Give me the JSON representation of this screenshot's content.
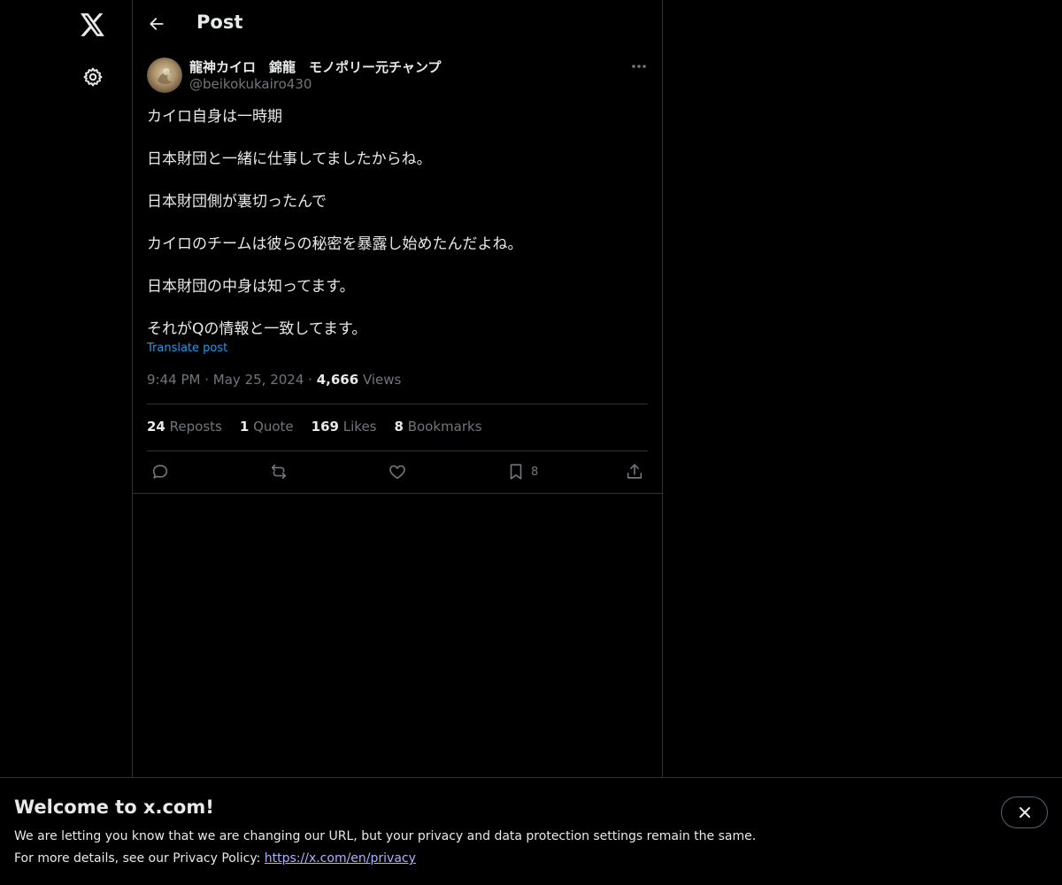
{
  "header": {
    "title": "Post"
  },
  "post": {
    "author": {
      "display_name": "龍神カイロ　錦龍　モノポリー元チャンプ",
      "handle": "@beikokukairo430"
    },
    "lines": [
      "カイロ自身は一時期",
      "",
      "日本財団と一緒に仕事してましたからね。",
      "",
      "日本財団側が裏切ったんで",
      "",
      "カイロのチームは彼らの秘密を暴露し始めたんだよね。",
      "",
      "日本財団の中身は知ってます。",
      "",
      "それがQの情報と一致してます。"
    ],
    "translate_label": "Translate post",
    "time": "9:44 PM",
    "separator": "·",
    "date": "May 25, 2024",
    "views_count": "4,666",
    "views_label": "Views"
  },
  "stats": {
    "reposts": {
      "count": "24",
      "label": "Reposts"
    },
    "quotes": {
      "count": "1",
      "label": "Quote"
    },
    "likes": {
      "count": "169",
      "label": "Likes"
    },
    "bookmarks": {
      "count": "8",
      "label": "Bookmarks"
    }
  },
  "actions": {
    "reply_icon": "reply-icon",
    "repost_icon": "repost-icon",
    "like_icon": "heart-icon",
    "bookmark_icon": "bookmark-icon",
    "bookmark_count": "8",
    "share_icon": "share-icon"
  },
  "banner": {
    "title": "Welcome to x.com!",
    "line1": "We are letting you know that we are changing our URL, but your privacy and data protection settings remain the same.",
    "line2_prefix": "For more details, see our Privacy Policy: ",
    "link": "https://x.com/en/privacy"
  },
  "colors": {
    "background": "#000000",
    "text": "#e7e9ea",
    "secondary": "#71767b",
    "accent": "#1d9bf0",
    "border": "#2f3336"
  }
}
